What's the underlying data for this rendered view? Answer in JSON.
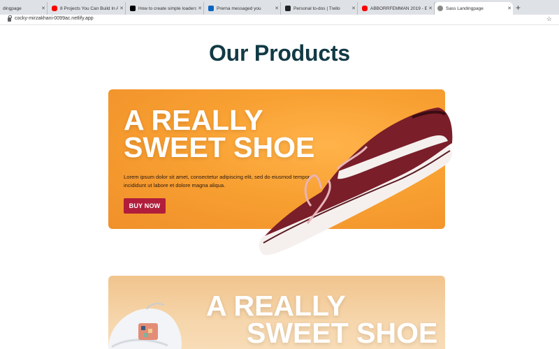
{
  "browser": {
    "tabs": [
      {
        "label": "dingpage",
        "icon": "page-icon"
      },
      {
        "label": "8 Projects You Can Build In A W",
        "icon": "youtube-icon"
      },
      {
        "label": "How to create simple loaders in",
        "icon": "medium-icon"
      },
      {
        "label": "Prerna messaged you",
        "icon": "linkedin-icon"
      },
      {
        "label": "Personal to-dos | Trello",
        "icon": "trello-icon"
      },
      {
        "label": "ABBORRFEMMAN 2019 - Episo",
        "icon": "youtube-icon"
      },
      {
        "label": "Sass Landingpage",
        "icon": "globe-icon"
      }
    ],
    "url": "cocky-mirzakhani-0099ac.netlify.app",
    "colors": {
      "youtube": "#ff0000",
      "linkedin": "#0a66c2",
      "trello": "#222222",
      "medium": "#000000"
    }
  },
  "page": {
    "title": "Our Products",
    "products": [
      {
        "headline_line1": "A REALLY",
        "headline_line2": "SWEET SHOE",
        "description": "Lorem ipsum dolor sit amet, consectetur adipiscing elit, sed do eiusmod tempor incididunt ut labore et dolore magna aliqua.",
        "button_label": "BUY NOW"
      },
      {
        "headline_line1": "A REALLY",
        "headline_line2": "SWEET SHOE"
      }
    ],
    "colors": {
      "title": "#113a45",
      "button": "#b11e3c",
      "card1": "#f8a032",
      "card2": "#f4cf9f"
    }
  }
}
